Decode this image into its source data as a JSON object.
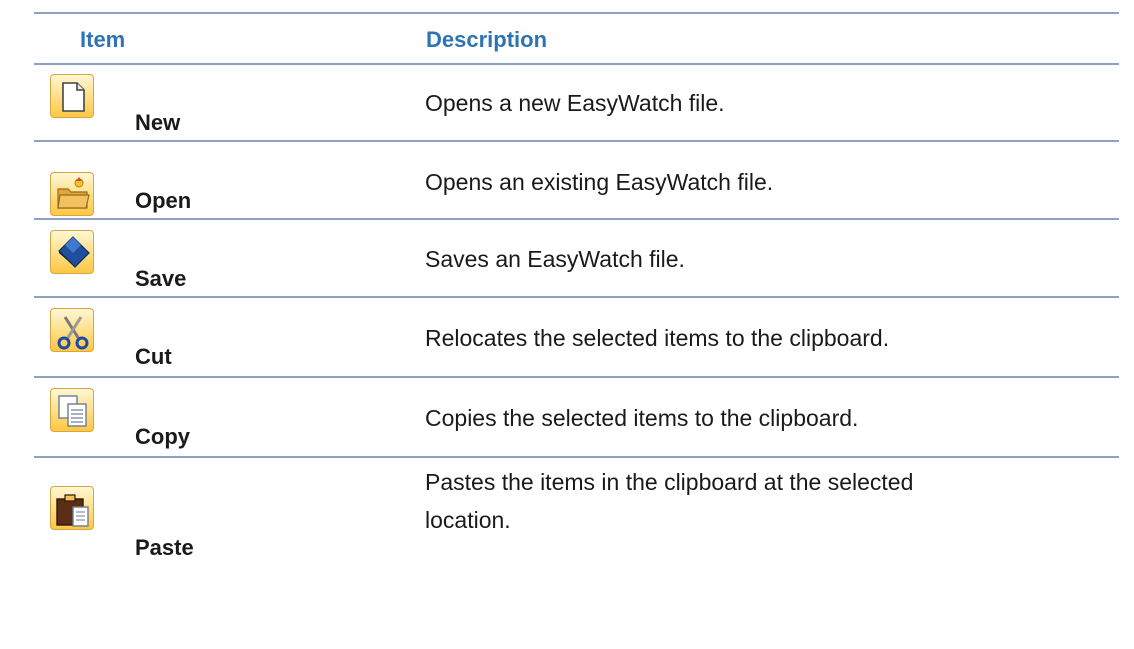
{
  "header": {
    "item": "Item",
    "description": "Description"
  },
  "rows": [
    {
      "label": "New",
      "icon": "new-file-icon",
      "description": "Opens a new EasyWatch file."
    },
    {
      "label": "Open",
      "icon": "open-folder-icon",
      "description": "Opens an existing EasyWatch file."
    },
    {
      "label": "Save",
      "icon": "save-disk-icon",
      "description": "Saves an EasyWatch file."
    },
    {
      "label": "Cut",
      "icon": "scissors-icon",
      "description": "Relocates the selected items to the clipboard."
    },
    {
      "label": "Copy",
      "icon": "copy-icon",
      "description": "Copies the selected items to the clipboard."
    },
    {
      "label": "Paste",
      "icon": "paste-icon",
      "description": "Pastes the items in the clipboard at the selected location."
    }
  ],
  "colors": {
    "header_text": "#2e74b5",
    "rule": "#8fa0c2",
    "icon_gradient": [
      "#fff7d6",
      "#ffc744"
    ]
  }
}
